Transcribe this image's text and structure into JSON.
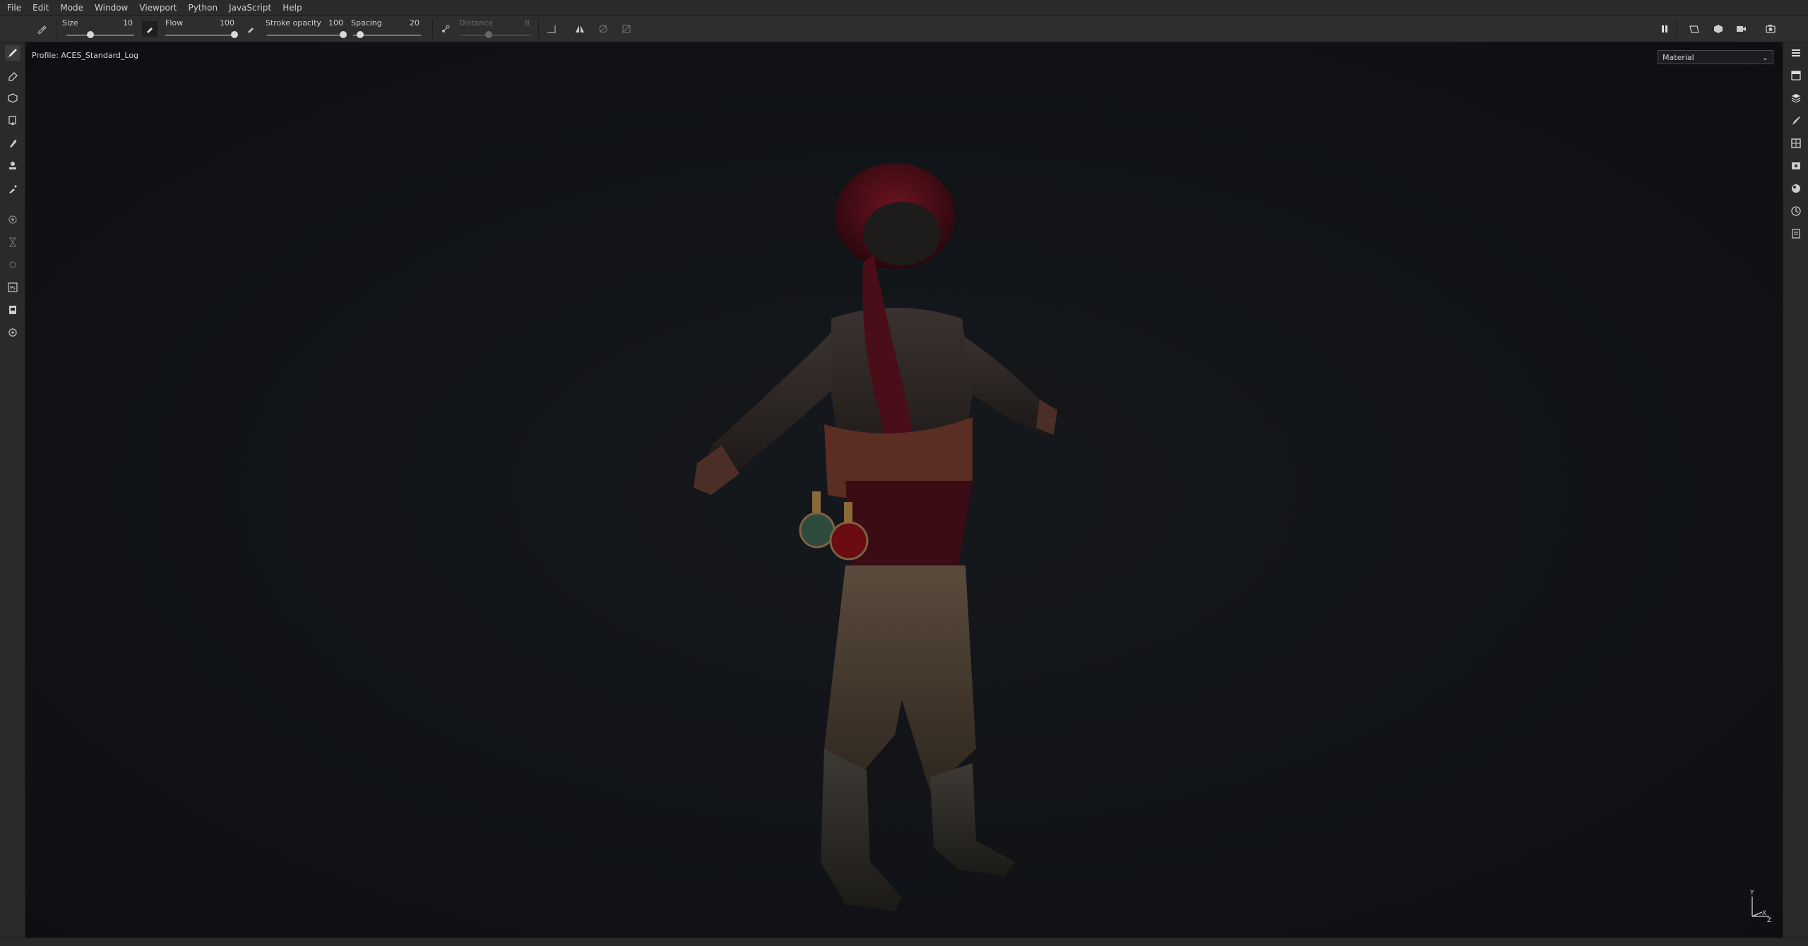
{
  "menu": {
    "items": [
      "File",
      "Edit",
      "Mode",
      "Window",
      "Viewport",
      "Python",
      "JavaScript",
      "Help"
    ]
  },
  "toolbar": {
    "size": {
      "label": "Size",
      "value": "10",
      "fraction": 0.35
    },
    "flow": {
      "label": "Flow",
      "value": "100",
      "fraction": 1.0
    },
    "stroke_opacity": {
      "label": "Stroke opacity",
      "value": "100",
      "fraction": 1.0
    },
    "spacing": {
      "label": "Spacing",
      "value": "20",
      "fraction": 0.1
    },
    "distance": {
      "label": "Distance",
      "value": "8",
      "fraction": 0.4,
      "disabled": true
    }
  },
  "viewport": {
    "profile_label": "Profile: ACES_Standard_Log",
    "mode_select": "Material",
    "axis_labels": {
      "y": "Y",
      "x": "X",
      "z": "Z"
    }
  },
  "colors": {
    "menubar_bg": "#2b2b2b",
    "toolbar_bg": "#2e2e2e",
    "viewport_bg": "#101216",
    "accent": "#d8d8d8"
  },
  "icons": {
    "left_tools": [
      "paint-brush-icon",
      "eraser-icon",
      "projection-icon",
      "geometry-decal-icon",
      "smudge-icon",
      "clone-stamp-icon",
      "color-picker-icon",
      "bake-icon",
      "path-icon",
      "symmetry-icon",
      "photoshop-export-icon",
      "material-export-icon",
      "settings-icon"
    ],
    "right_panels": [
      "layers-stack-icon",
      "texture-set-icon",
      "layer-icon",
      "brush-properties-icon",
      "display-settings-icon",
      "viewer-settings-icon",
      "shader-settings-icon",
      "history-icon",
      "log-icon"
    ],
    "toolbar_right": [
      "pause-icon",
      "perspective-icon",
      "camera-icon",
      "video-icon",
      "screenshot-icon"
    ]
  }
}
